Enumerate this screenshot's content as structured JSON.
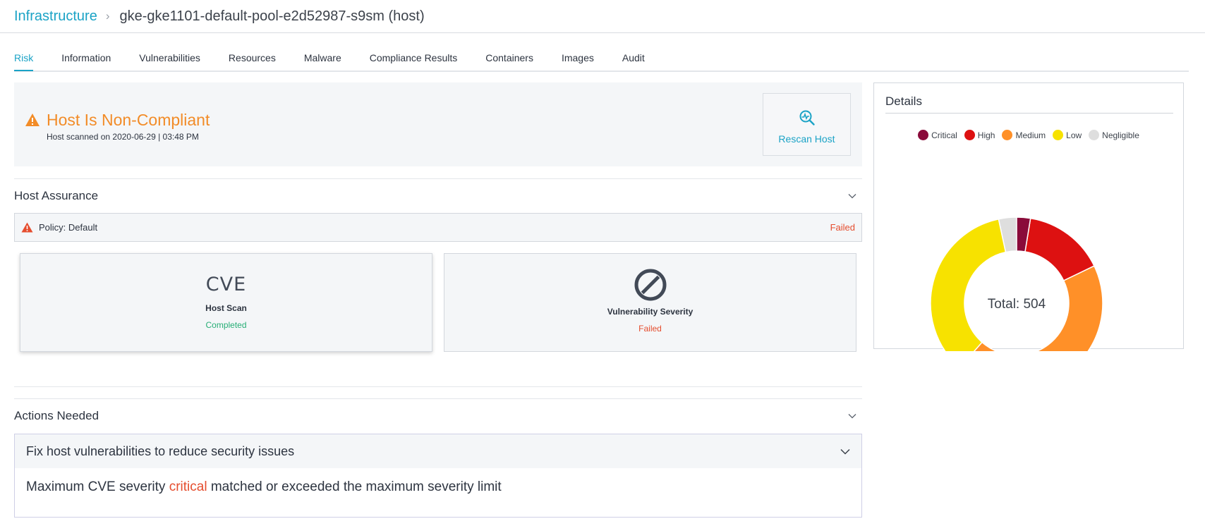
{
  "breadcrumb": {
    "root": "Infrastructure",
    "separator": "›",
    "current": "gke-gke1101-default-pool-e2d52987-s9sm (host)"
  },
  "tabs": [
    "Risk",
    "Information",
    "Vulnerabilities",
    "Resources",
    "Malware",
    "Compliance Results",
    "Containers",
    "Images",
    "Audit"
  ],
  "active_tab": "Risk",
  "status": {
    "title": "Host Is Non-Compliant",
    "subtitle": "Host scanned on 2020-06-29 | 03:48 PM",
    "icon": "warning-triangle-icon",
    "rescan_label": "Rescan Host"
  },
  "host_assurance": {
    "title": "Host Assurance",
    "policy_label": "Policy: Default",
    "policy_status": "Failed",
    "checks": [
      {
        "icon_text": "CVE",
        "name": "Host Scan",
        "status": "Completed"
      },
      {
        "icon": "prohibited-icon",
        "name": "Vulnerability Severity",
        "status": "Failed"
      }
    ]
  },
  "actions": {
    "title": "Actions Needed",
    "item_title": "Fix host vulnerabilities to reduce security issues",
    "body_prefix": "Maximum CVE severity ",
    "body_highlight": "critical",
    "body_suffix": " matched or exceeded the maximum severity limit"
  },
  "details": {
    "title": "Details",
    "total_label": "Total: 504"
  },
  "colors": {
    "accent": "#1ba3c6",
    "warning": "#f28c28",
    "failed": "#e54d2e",
    "ok": "#27ae76"
  },
  "chart_data": {
    "type": "pie",
    "legend_position": "top",
    "total": 504,
    "series": [
      {
        "name": "Critical",
        "value": 13,
        "color": "#8a0b3a"
      },
      {
        "name": "High",
        "value": 77,
        "color": "#dd1111"
      },
      {
        "name": "Medium",
        "value": 220,
        "color": "#ff9028"
      },
      {
        "name": "Low",
        "value": 177,
        "color": "#f7e200"
      },
      {
        "name": "Negligible",
        "value": 17,
        "color": "#dedede"
      }
    ]
  }
}
